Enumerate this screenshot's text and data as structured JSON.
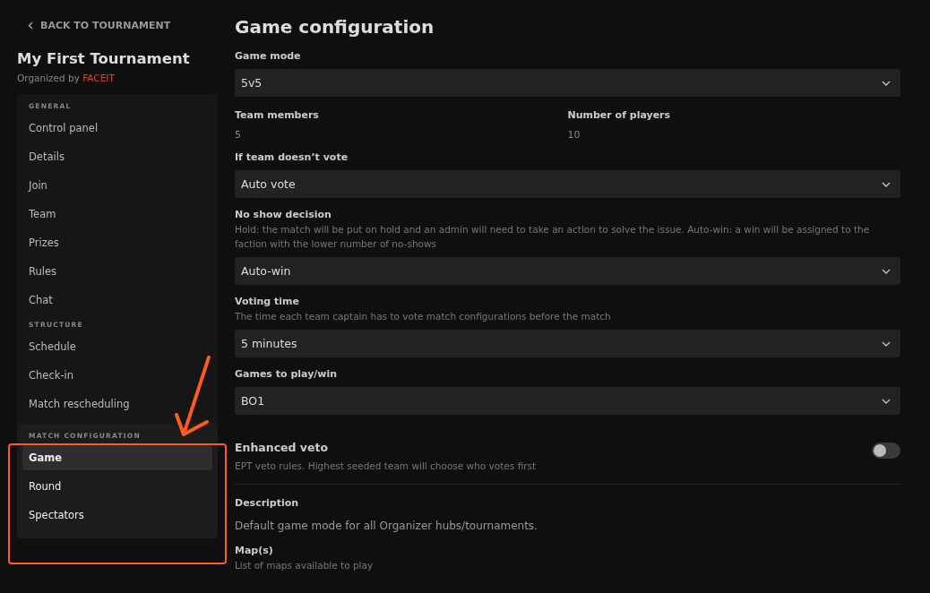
{
  "back_link": "BACK TO TOURNAMENT",
  "tournament": {
    "name": "My First Tournament",
    "organized_by": "Organized by",
    "organizer": "FACEIT"
  },
  "sidebar": {
    "sections": [
      {
        "heading": "GENERAL",
        "items": [
          {
            "label": "Control panel",
            "selected": false
          },
          {
            "label": "Details",
            "selected": false
          },
          {
            "label": "Join",
            "selected": false
          },
          {
            "label": "Team",
            "selected": false
          },
          {
            "label": "Prizes",
            "selected": false
          },
          {
            "label": "Rules",
            "selected": false
          },
          {
            "label": "Chat",
            "selected": false
          }
        ]
      },
      {
        "heading": "STRUCTURE",
        "items": [
          {
            "label": "Schedule",
            "selected": false
          },
          {
            "label": "Check-in",
            "selected": false
          },
          {
            "label": "Match rescheduling",
            "selected": false
          }
        ]
      },
      {
        "heading": "MATCH CONFIGURATION",
        "items": [
          {
            "label": "Game",
            "selected": true
          },
          {
            "label": "Round",
            "selected": false
          },
          {
            "label": "Spectators",
            "selected": false
          }
        ]
      }
    ]
  },
  "page_title": "Game configuration",
  "fields": [
    {
      "kind": "select",
      "label": "Game mode",
      "value": "5v5"
    },
    {
      "kind": "pair",
      "items": [
        {
          "label": "Team members",
          "value": "5"
        },
        {
          "label": "Number of players",
          "value": "10"
        }
      ]
    },
    {
      "kind": "select",
      "label": "If team doesn’t vote",
      "value": "Auto vote"
    },
    {
      "kind": "select",
      "label": "No show decision",
      "hint": "Hold: the match will be put on hold and an admin will need to take an action to solve the issue. Auto-win: a win will be assigned to the faction with the lower number of no-shows",
      "value": "Auto-win"
    },
    {
      "kind": "select",
      "label": "Voting time",
      "hint": "The time each team captain has to vote match configurations before the match",
      "value": "5 minutes"
    },
    {
      "kind": "select",
      "label": "Games to play/win",
      "value": "BO1"
    },
    {
      "kind": "toggle",
      "label": "Enhanced veto",
      "hint": "EPT veto rules. Highest seeded team will choose who votes first",
      "on": false
    },
    {
      "kind": "text",
      "label": "Description",
      "value": "Default game mode for all Organizer hubs/tournaments."
    },
    {
      "kind": "text",
      "label": "Map(s)",
      "hint": "List of maps available to play"
    }
  ]
}
